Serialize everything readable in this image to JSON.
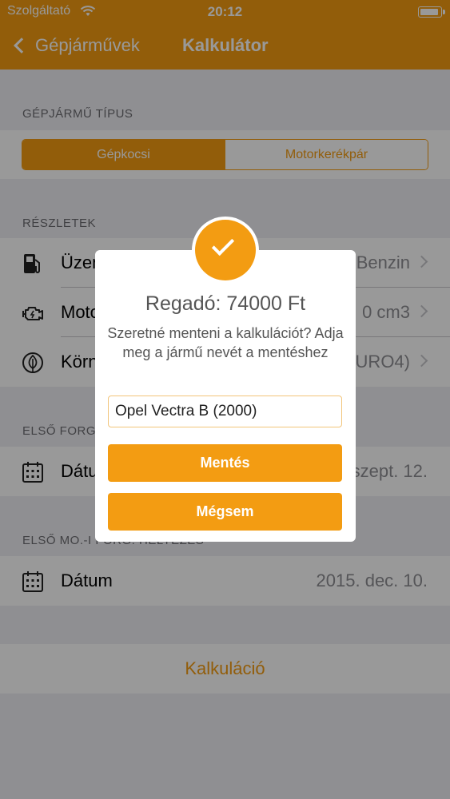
{
  "status": {
    "carrier": "Szolgáltató",
    "time": "20:12"
  },
  "nav": {
    "back_label": "Gépjárművek",
    "title": "Kalkulátor"
  },
  "vehicle_type": {
    "header": "GÉPJÁRMŰ TÍPUS",
    "options": [
      "Gépkocsi",
      "Motorkerékpár"
    ],
    "selected": "Gépkocsi"
  },
  "details": {
    "header": "RÉSZLETEK",
    "rows": [
      {
        "label": "Üzem",
        "value": "Benzin",
        "icon": "fuel-pump-icon"
      },
      {
        "label": "Motor",
        "value": "0 cm3",
        "icon": "engine-icon"
      },
      {
        "label": "Körny",
        "value": "URO4)",
        "icon": "leaf-icon"
      }
    ]
  },
  "first_registration": {
    "header": "ELSŐ FORG",
    "label": "Dátum",
    "value": "szept. 12.",
    "icon": "calendar-icon"
  },
  "first_hu_registration": {
    "header": "ELSŐ MO.-I FORG. HELYEZÉS",
    "label": "Dátum",
    "value": "2015. dec. 10.",
    "icon": "calendar-icon"
  },
  "calculate_label": "Kalkuláció",
  "modal": {
    "title": "Regadó: 74000 Ft",
    "message": "Szeretné menteni a kalkulációt? Adja meg a jármű nevét a mentéshez",
    "input_value": "Opel Vectra B (2000)",
    "save_label": "Mentés",
    "cancel_label": "Mégsem",
    "icon": "checkmark-icon"
  },
  "colors": {
    "accent": "#f39c12",
    "background": "#efeff4"
  }
}
